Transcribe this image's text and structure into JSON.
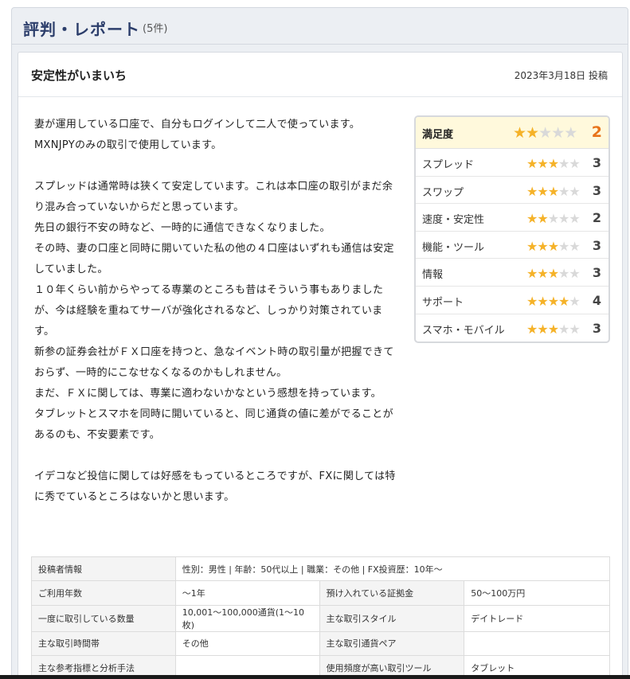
{
  "section": {
    "title": "評判・レポート",
    "count": "(5件)"
  },
  "review": {
    "title": "安定性がいまいち",
    "date": "2023年3月18日 投稿",
    "body": [
      "妻が運用している口座で、自分もログインして二人で使っています。",
      "MXNJPYのみの取引で使用しています。",
      "",
      "スプレッドは通常時は狭くて安定しています。これは本口座の取引がまだ余り混み合っていないからだと思っています。",
      "先日の銀行不安の時など、一時的に通信できなくなりました。",
      "その時、妻の口座と同時に開いていた私の他の４口座はいずれも通信は安定していました。",
      "１０年くらい前からやってる専業のところも昔はそういう事もありましたが、今は経験を重ねてサーバが強化されるなど、しっかり対策されています。",
      "新参の証券会社がＦＸ口座を持つと、急なイベント時の取引量が把握できておらず、一時的にこなせなくなるのかもしれません。",
      "まだ、ＦＸに関しては、専業に適わないかなという感想を持っています。",
      "タブレットとスマホを同時に開いていると、同じ通貨の値に差がでることがあるのも、不安要素です。",
      "",
      "イデコなど投信に関しては好感をもっているところですが、FXに関しては特に秀でているところはないかと思います。"
    ]
  },
  "ratings": {
    "overall": {
      "label": "満足度",
      "score": 2,
      "score_text": "2"
    },
    "items": [
      {
        "label": "スプレッド",
        "score": 3,
        "score_text": "3"
      },
      {
        "label": "スワップ",
        "score": 3,
        "score_text": "3"
      },
      {
        "label": "速度・安定性",
        "score": 2,
        "score_text": "2"
      },
      {
        "label": "機能・ツール",
        "score": 3,
        "score_text": "3"
      },
      {
        "label": "情報",
        "score": 3,
        "score_text": "3"
      },
      {
        "label": "サポート",
        "score": 4,
        "score_text": "4"
      },
      {
        "label": "スマホ・モバイル",
        "score": 3,
        "score_text": "3"
      }
    ],
    "max_stars": 5,
    "colors": {
      "star_on": "#f5b228",
      "star_off": "#d9d9d9",
      "overall_score": "#e8731a"
    }
  },
  "info": {
    "poster_label": "投稿者情報",
    "poster_value": "性別：男性 | 年齢：50代以上 | 職業：その他 | FX投資歴：10年〜",
    "rows": [
      {
        "k1": "ご利用年数",
        "v1": "〜1年",
        "k2": "預け入れている証拠金",
        "v2": "50〜100万円"
      },
      {
        "k1": "一度に取引している数量",
        "v1": "10,001〜100,000通貨(1〜10枚)",
        "k2": "主な取引スタイル",
        "v2": "デイトレード"
      },
      {
        "k1": "主な取引時間帯",
        "v1": "その他",
        "k2": "主な取引通貨ペア",
        "v2": ""
      },
      {
        "k1": "主な参考指標と分析手法",
        "v1": "",
        "k2": "使用頻度が高い取引ツール",
        "v2": "タブレット"
      }
    ]
  }
}
